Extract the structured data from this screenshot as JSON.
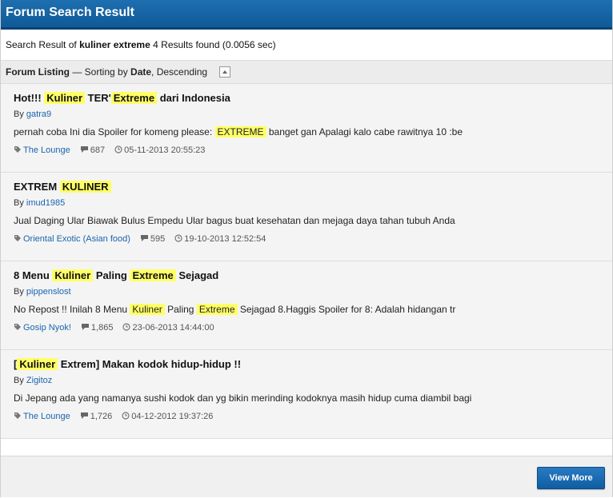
{
  "header": {
    "title": "Forum Search Result"
  },
  "summary": {
    "prefix": "Search Result of",
    "query": "kuliner extreme",
    "count": "4",
    "suffix": "Results found (0.0056 sec)"
  },
  "listing": {
    "title": "Forum Listing",
    "dash": " — Sorting by ",
    "sort_field": "Date",
    "sort_order": ", Descending"
  },
  "results": [
    {
      "title": [
        {
          "t": "Hot!!! ",
          "hl": false
        },
        {
          "t": "Kuliner",
          "hl": true
        },
        {
          "t": " TER'",
          "hl": false
        },
        {
          "t": "Extreme",
          "hl": true
        },
        {
          "t": " dari Indonesia",
          "hl": false
        }
      ],
      "by_label": "By",
      "author": "gatra9",
      "snippet": [
        {
          "t": "pernah coba Ini dia Spoiler for komeng please: ",
          "hl": false
        },
        {
          "t": "EXTREME",
          "hl": true
        },
        {
          "t": " banget gan Apalagi kalo cabe rawitnya 10 :be",
          "hl": false
        }
      ],
      "forum": "The Lounge",
      "replies": "687",
      "date": "05-11-2013 20:55:23"
    },
    {
      "title": [
        {
          "t": "EXTREM ",
          "hl": false
        },
        {
          "t": "KULINER",
          "hl": true
        }
      ],
      "by_label": "By",
      "author": "imud1985",
      "snippet": [
        {
          "t": "Jual Daging Ular Biawak Bulus Empedu Ular bagus buat kesehatan dan mejaga daya tahan tubuh Anda",
          "hl": false
        }
      ],
      "forum": "Oriental Exotic (Asian food)",
      "replies": "595",
      "date": "19-10-2013 12:52:54"
    },
    {
      "title": [
        {
          "t": "8 Menu ",
          "hl": false
        },
        {
          "t": "Kuliner",
          "hl": true
        },
        {
          "t": " Paling ",
          "hl": false
        },
        {
          "t": "Extreme",
          "hl": true
        },
        {
          "t": " Sejagad",
          "hl": false
        }
      ],
      "by_label": "By",
      "author": "pippenslost",
      "snippet": [
        {
          "t": "No Repost !! Inilah 8 Menu ",
          "hl": false
        },
        {
          "t": "Kuliner",
          "hl": true
        },
        {
          "t": " Paling ",
          "hl": false
        },
        {
          "t": "Extreme",
          "hl": true
        },
        {
          "t": " Sejagad 8.Haggis Spoiler for 8: Adalah hidangan tr",
          "hl": false
        }
      ],
      "forum": "Gosip Nyok!",
      "replies": "1,865",
      "date": "23-06-2013 14:44:00"
    },
    {
      "title": [
        {
          "t": "[",
          "hl": false
        },
        {
          "t": "Kuliner",
          "hl": true
        },
        {
          "t": " Extrem] Makan kodok hidup-hidup !!",
          "hl": false
        }
      ],
      "by_label": "By",
      "author": "Zigitoz",
      "snippet": [
        {
          "t": "Di Jepang ada yang namanya sushi kodok dan yg bikin merinding kodoknya masih hidup cuma diambil bagi",
          "hl": false
        }
      ],
      "forum": "The Lounge",
      "replies": "1,726",
      "date": "04-12-2012 19:37:26"
    }
  ],
  "footer": {
    "view_more": "View More"
  },
  "colors": {
    "header_bg": "#1565a8",
    "highlight": "#ffff66",
    "link": "#1a64b0",
    "button": "#1a6cb3"
  },
  "icons": {
    "tag": "tag-icon",
    "replies": "comment-icon",
    "date": "clock-icon",
    "collapse": "collapse-arrow-icon"
  }
}
